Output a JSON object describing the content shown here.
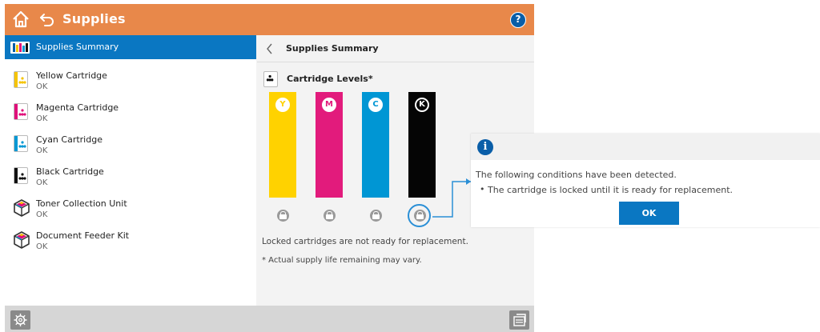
{
  "header": {
    "title": "Supplies",
    "help_label": "?"
  },
  "list": {
    "selected_label": "Supplies Summary",
    "items": [
      {
        "name": "Yellow Cartridge",
        "status": "OK",
        "color": "#f5c400"
      },
      {
        "name": "Magenta Cartridge",
        "status": "OK",
        "color": "#e0107a"
      },
      {
        "name": "Cyan Cartridge",
        "status": "OK",
        "color": "#0098d4"
      },
      {
        "name": "Black Cartridge",
        "status": "OK",
        "color": "#111111"
      },
      {
        "name": "Toner Collection Unit",
        "status": "OK"
      },
      {
        "name": "Document Feeder Kit",
        "status": "OK"
      }
    ]
  },
  "pane": {
    "title": "Supplies Summary",
    "levels_title": "Cartridge Levels*",
    "cartridges": [
      {
        "letter": "Y",
        "color": "#ffd200",
        "level": 1.0,
        "locked": true
      },
      {
        "letter": "M",
        "color": "#e21b7c",
        "level": 1.0,
        "locked": true
      },
      {
        "letter": "C",
        "color": "#0096d4",
        "level": 1.0,
        "locked": true
      },
      {
        "letter": "K",
        "color": "#050505",
        "level": 1.0,
        "locked": true
      }
    ],
    "note_locked": "Locked cartridges are not ready for replacement.",
    "note_actual": "* Actual supply life remaining may vary."
  },
  "popup": {
    "icon": "info-icon",
    "message": "The following conditions have been detected.",
    "bullet": "The cartridge is locked until it is ready for replacement.",
    "ok_label": "OK"
  },
  "colors": {
    "header": "#e8884a",
    "selected": "#0a77c2",
    "accent": "#0a5ea8"
  }
}
